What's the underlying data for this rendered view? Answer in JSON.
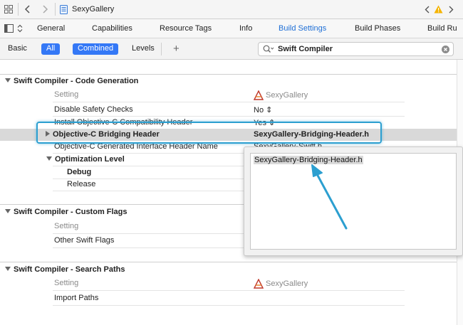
{
  "jumpbar": {
    "file_name": "SexyGallery"
  },
  "tabs": [
    {
      "label": "General",
      "active": false
    },
    {
      "label": "Capabilities",
      "active": false
    },
    {
      "label": "Resource Tags",
      "active": false
    },
    {
      "label": "Info",
      "active": false
    },
    {
      "label": "Build Settings",
      "active": true
    },
    {
      "label": "Build Phases",
      "active": false
    },
    {
      "label": "Build Ru",
      "active": false
    }
  ],
  "filter": {
    "basic": "Basic",
    "all": "All",
    "combined": "Combined",
    "levels": "Levels",
    "add": "+",
    "search_value": "Swift Compiler"
  },
  "sections": {
    "codegen": {
      "title": "Swift Compiler - Code Generation",
      "setting_header": "Setting",
      "target_header": "SexyGallery",
      "rows": [
        {
          "label": "Disable Safety Checks",
          "value": "No"
        },
        {
          "label": "Install Objective-C Compatibility Header",
          "value": "Yes"
        },
        {
          "label": "Objective-C Bridging Header",
          "value": "SexyGallery-Bridging-Header.h"
        },
        {
          "label": "Objective-C Generated Interface Header Name",
          "value": "SexyGallery-Swift.h"
        },
        {
          "label": "Optimization Level",
          "value": ""
        },
        {
          "label": "Debug",
          "value": ""
        },
        {
          "label": "Release",
          "value": ""
        }
      ]
    },
    "custom": {
      "title": "Swift Compiler - Custom Flags",
      "setting_header": "Setting",
      "rows": [
        {
          "label": "Other Swift Flags",
          "value": ""
        }
      ]
    },
    "search": {
      "title": "Swift Compiler - Search Paths",
      "setting_header": "Setting",
      "target_header": "SexyGallery",
      "rows": [
        {
          "label": "Import Paths",
          "value": ""
        }
      ]
    }
  },
  "popup": {
    "text": "SexyGallery-Bridging-Header.h"
  },
  "colors": {
    "accent": "#3478f6",
    "highlight": "#2c9fd0",
    "warning": "#f5b400"
  }
}
